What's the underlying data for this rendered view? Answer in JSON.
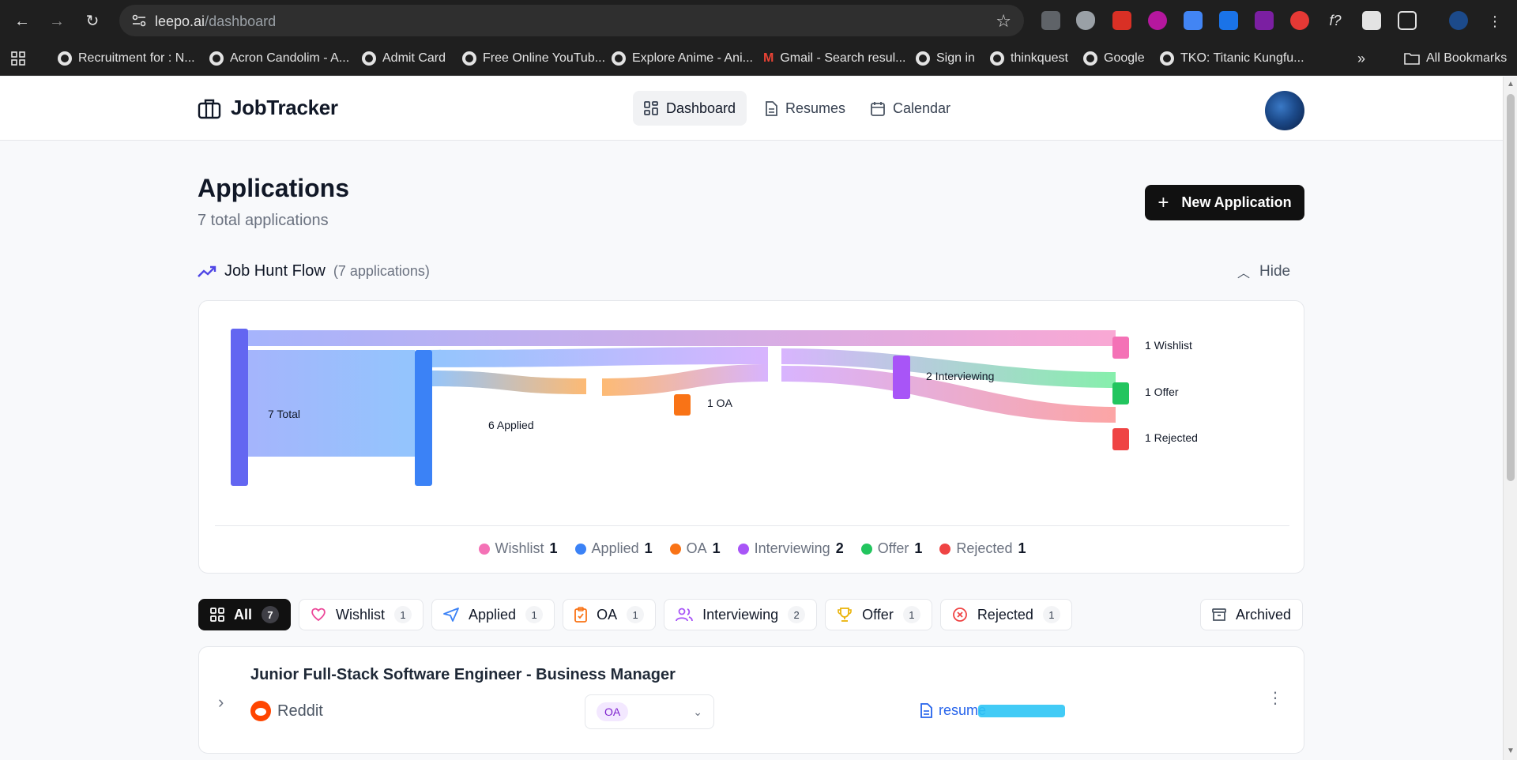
{
  "browser": {
    "url_host": "leepo.ai",
    "url_path": "/dashboard",
    "bookmarks": [
      "Recruitment for : N...",
      "Acron Candolim - A...",
      "Admit Card",
      "Free Online YouTub...",
      "Explore Anime - Ani...",
      "Gmail - Search resul...",
      "Sign in",
      "thinkquest",
      "Google",
      "TKO: Titanic Kungfu..."
    ],
    "all_bookmarks": "All Bookmarks"
  },
  "header": {
    "brand": "JobTracker",
    "nav": [
      "Dashboard",
      "Resumes",
      "Calendar"
    ],
    "active_nav": "Dashboard"
  },
  "page": {
    "title": "Applications",
    "subtitle": "7 total applications",
    "new_button": "New Application"
  },
  "flow": {
    "title": "Job Hunt Flow",
    "count_text": "(7 applications)",
    "hide_label": "Hide",
    "nodes": {
      "total": "7 Total",
      "applied": "6 Applied",
      "oa": "1 OA",
      "interviewing": "2 Interviewing",
      "wishlist": "1 Wishlist",
      "offer": "1 Offer",
      "rejected": "1 Rejected"
    },
    "legend": [
      {
        "label": "Wishlist",
        "count": "1",
        "color": "#f472b6"
      },
      {
        "label": "Applied",
        "count": "1",
        "color": "#3b82f6"
      },
      {
        "label": "OA",
        "count": "1",
        "color": "#f97316"
      },
      {
        "label": "Interviewing",
        "count": "2",
        "color": "#a855f7"
      },
      {
        "label": "Offer",
        "count": "1",
        "color": "#22c55e"
      },
      {
        "label": "Rejected",
        "count": "1",
        "color": "#ef4444"
      }
    ]
  },
  "tabs": [
    {
      "label": "All",
      "count": "7"
    },
    {
      "label": "Wishlist",
      "count": "1"
    },
    {
      "label": "Applied",
      "count": "1"
    },
    {
      "label": "OA",
      "count": "1"
    },
    {
      "label": "Interviewing",
      "count": "2"
    },
    {
      "label": "Offer",
      "count": "1"
    },
    {
      "label": "Rejected",
      "count": "1"
    }
  ],
  "archived_label": "Archived",
  "applications": [
    {
      "title": "Junior Full-Stack Software Engineer - Business Manager",
      "company": "Reddit",
      "status": "OA",
      "resume": "resume"
    }
  ],
  "colors": {
    "accent": "#111111",
    "total_node": "#6366f1",
    "applied_node": "#3b82f6",
    "oa_node": "#f97316",
    "interviewing_node": "#a855f7",
    "wishlist_node": "#f472b6",
    "offer_node": "#22c55e",
    "rejected_node": "#ef4444"
  }
}
